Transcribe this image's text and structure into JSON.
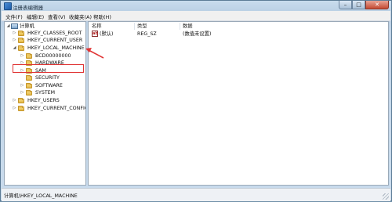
{
  "window": {
    "title": "注册表编辑器"
  },
  "menubar": [
    "文件(F)",
    "编辑(E)",
    "查看(V)",
    "收藏夹(A)",
    "帮助(H)"
  ],
  "tree": {
    "root": "计算机",
    "items": [
      {
        "label": "HKEY_CLASSES_ROOT",
        "expanded": false
      },
      {
        "label": "HKEY_CURRENT_USER",
        "expanded": false
      },
      {
        "label": "HKEY_LOCAL_MACHINE",
        "expanded": true,
        "selected": true,
        "children": [
          "BCD00000000",
          "HARDWARE",
          "SAM",
          "SECURITY",
          "SOFTWARE",
          "SYSTEM"
        ]
      },
      {
        "label": "HKEY_USERS",
        "expanded": false
      },
      {
        "label": "HKEY_CURRENT_CONFIG",
        "expanded": false
      }
    ]
  },
  "values": {
    "columns": [
      "名称",
      "类型",
      "数据"
    ],
    "rows": [
      {
        "name": "(默认)",
        "type": "REG_SZ",
        "data": "(数值未设置)"
      }
    ]
  },
  "statusbar": {
    "path": "计算机\\HKEY_LOCAL_MACHINE"
  },
  "colors": {
    "highlight": "#e03434"
  }
}
